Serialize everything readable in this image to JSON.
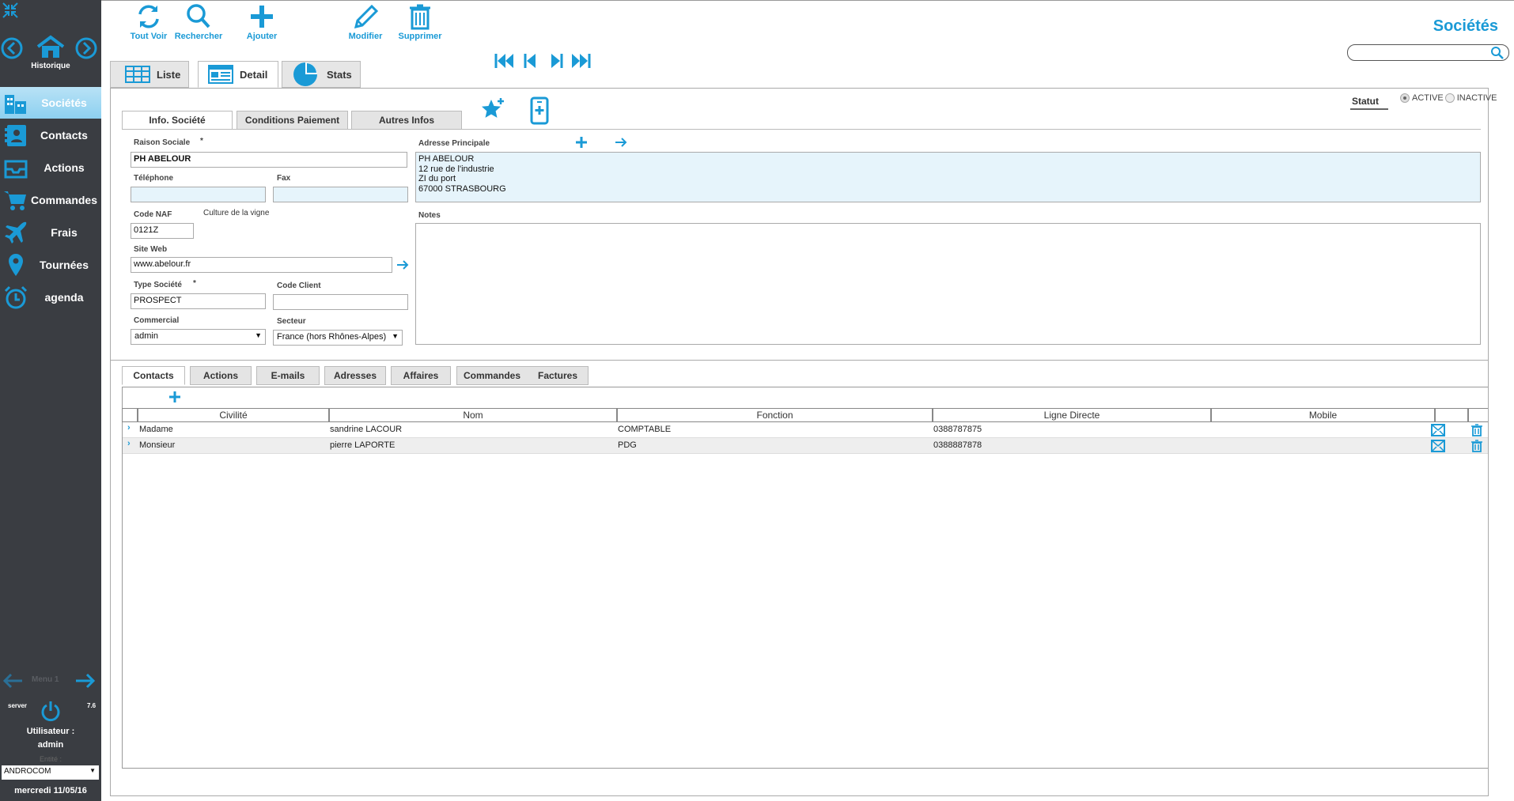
{
  "sidebar": {
    "history_label": "Historique",
    "items": [
      {
        "label": "Sociétés",
        "icon": "building-icon",
        "active": true
      },
      {
        "label": "Contacts",
        "icon": "contact-card-icon"
      },
      {
        "label": "Actions",
        "icon": "inbox-tray-icon"
      },
      {
        "label": "Commandes",
        "icon": "cart-icon"
      },
      {
        "label": "Frais",
        "icon": "airplane-icon"
      },
      {
        "label": "Tournées",
        "icon": "map-pin-icon"
      },
      {
        "label": "agenda",
        "icon": "alarm-clock-icon"
      }
    ],
    "menu_label": "Menu 1",
    "server_label": "server",
    "version": "7.6",
    "user_label": "Utilisateur :",
    "user_name": "admin",
    "entity_label": "Entité :",
    "entity_value": "ANDROCOM",
    "date": "mercredi 11/05/16"
  },
  "toolbar": {
    "buttons": [
      {
        "label": "Tout Voir",
        "icon": "refresh-icon"
      },
      {
        "label": "Rechercher",
        "icon": "search-icon"
      },
      {
        "label": "Ajouter",
        "icon": "plus-icon"
      },
      {
        "label": "Modifier",
        "icon": "pencil-icon"
      },
      {
        "label": "Supprimer",
        "icon": "trash-icon"
      }
    ]
  },
  "header": {
    "title": "Sociétés",
    "search_value": ""
  },
  "view_tabs": {
    "list": "Liste",
    "detail": "Detail",
    "stats": "Stats",
    "active": "detail"
  },
  "statut": {
    "label": "Statut",
    "active": "ACTIVE",
    "inactive": "INACTIVE",
    "selected": "ACTIVE"
  },
  "info_tabs": [
    "Info. Société",
    "Conditions Paiement",
    "Autres Infos"
  ],
  "form": {
    "raison_sociale_label": "Raison Sociale",
    "required_mark": "*",
    "raison_sociale": "PH ABELOUR",
    "telephone_label": "Téléphone",
    "telephone": "",
    "fax_label": "Fax",
    "fax": "",
    "code_naf_label": "Code NAF",
    "code_naf_desc": "Culture de la vigne",
    "code_naf": "0121Z",
    "site_web_label": "Site Web",
    "site_web": "www.abelour.fr",
    "type_societe_label": "Type Société",
    "type_societe": "PROSPECT",
    "code_client_label": "Code Client",
    "code_client": "",
    "commercial_label": "Commercial",
    "commercial": "admin",
    "secteur_label": "Secteur",
    "secteur": "France (hors Rhônes-Alpes)",
    "adresse_label": "Adresse Principale",
    "adresse_lines": [
      "PH ABELOUR",
      "12 rue de l'industrie",
      "ZI du port",
      "67000 STRASBOURG"
    ],
    "notes_label": "Notes",
    "notes": ""
  },
  "bottom_tabs": [
    "Contacts",
    "Actions",
    "E-mails",
    "Adresses",
    "Affaires",
    "Commandes",
    "Factures"
  ],
  "contacts_table": {
    "headers": [
      "Civilité",
      "Nom",
      "Fonction",
      "Ligne Directe",
      "Mobile"
    ],
    "rows": [
      {
        "civilite": "Madame",
        "nom": "sandrine LACOUR",
        "fonction": "COMPTABLE",
        "ligne": "0388787875",
        "mobile": ""
      },
      {
        "civilite": "Monsieur",
        "nom": "pierre LAPORTE",
        "fonction": "PDG",
        "ligne": "0388887878",
        "mobile": ""
      }
    ]
  },
  "colors": {
    "accent": "#1a9ad6",
    "sidebar_bg": "#3a3d42",
    "active_nav": "#9fd8f2"
  }
}
